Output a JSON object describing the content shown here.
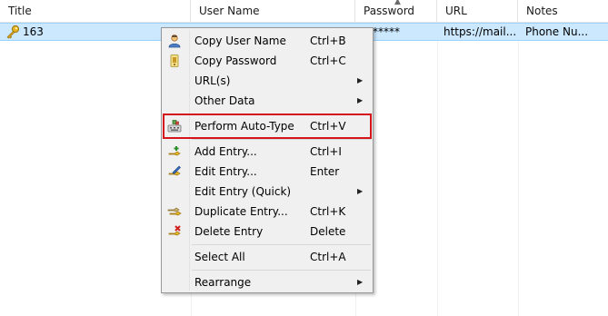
{
  "columns": [
    "Title",
    "User Name",
    "Password",
    "URL",
    "Notes"
  ],
  "row": {
    "title": "163",
    "username": "",
    "password": "*******",
    "url": "https://mail...",
    "notes": "Phone Nu..."
  },
  "menu": {
    "copy_username": {
      "label": "Copy User Name",
      "shortcut": "Ctrl+B",
      "icon": "user-icon"
    },
    "copy_password": {
      "label": "Copy Password",
      "shortcut": "Ctrl+C",
      "icon": "password-icon"
    },
    "urls": {
      "label": "URL(s)"
    },
    "other_data": {
      "label": "Other Data"
    },
    "auto_type": {
      "label": "Perform Auto-Type",
      "shortcut": "Ctrl+V",
      "icon": "auto-type-icon"
    },
    "add_entry": {
      "label": "Add Entry...",
      "shortcut": "Ctrl+I",
      "icon": "add-key-icon"
    },
    "edit_entry": {
      "label": "Edit Entry...",
      "shortcut": "Enter",
      "icon": "edit-key-icon"
    },
    "edit_quick": {
      "label": "Edit Entry (Quick)"
    },
    "duplicate": {
      "label": "Duplicate Entry...",
      "shortcut": "Ctrl+K",
      "icon": "duplicate-key-icon"
    },
    "delete": {
      "label": "Delete Entry",
      "shortcut": "Delete",
      "icon": "delete-key-icon"
    },
    "select_all": {
      "label": "Select All",
      "shortcut": "Ctrl+A"
    },
    "rearrange": {
      "label": "Rearrange"
    }
  },
  "colors": {
    "selection": "#cce8ff",
    "highlight_border": "#d6141c",
    "menu_bg": "#f0f0f0"
  }
}
